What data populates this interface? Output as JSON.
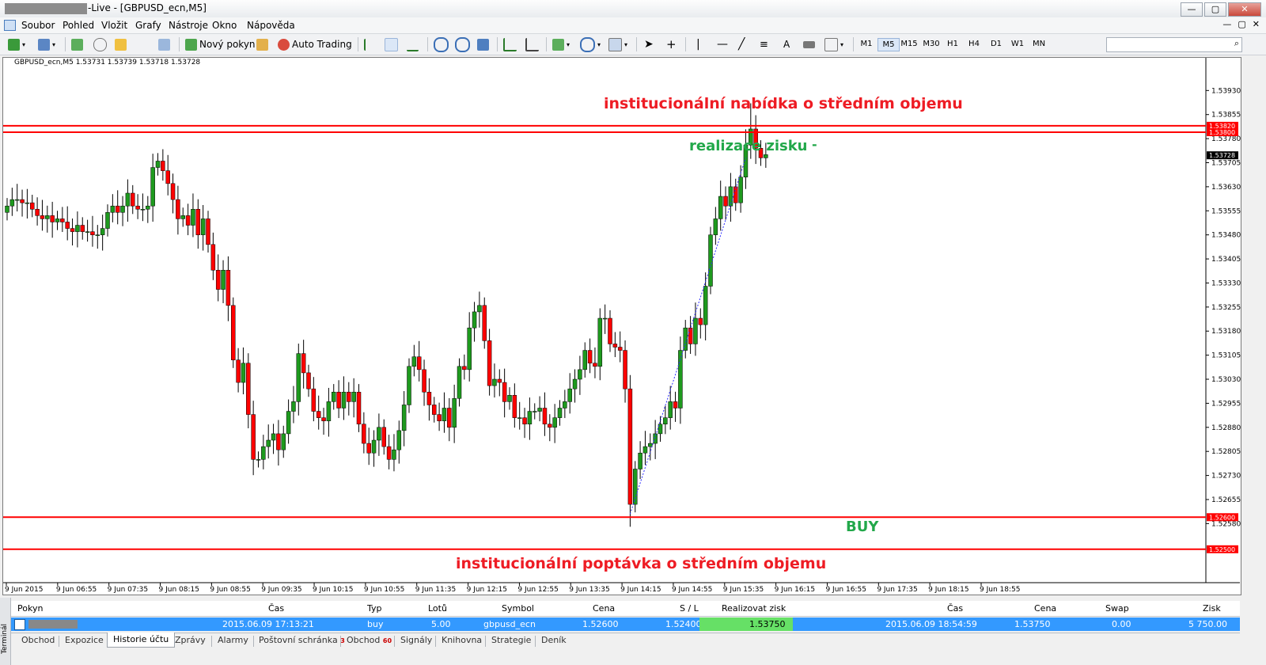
{
  "window": {
    "title": "-Live - [GBPUSD_ecn,M5]",
    "min": "—",
    "max": "▢",
    "close": "✕"
  },
  "menu": [
    "Soubor",
    "Pohled",
    "Vložit",
    "Grafy",
    "Nástroje",
    "Okno",
    "Nápověda"
  ],
  "toolbar": {
    "new_order": "Nový pokyn",
    "auto_trading": "Auto Trading",
    "timeframes": [
      "M1",
      "M5",
      "M15",
      "M30",
      "H1",
      "H4",
      "D1",
      "W1",
      "MN"
    ],
    "active_timeframe": "M5",
    "line_label": "A",
    "icons": [
      "new-chart-icon",
      "profiles-icon",
      "market-watch-icon",
      "navigator-icon",
      "favorites-icon",
      "tester-icon",
      "new-order-icon",
      "auto-trading-icon",
      "bar-chart-icon",
      "candles-icon",
      "line-chart-icon",
      "zoom-in-icon",
      "zoom-out-icon",
      "tile-icon",
      "autoscroll-icon",
      "chart-shift-icon",
      "indicators-icon",
      "periods-icon",
      "templates-icon",
      "cursor-icon",
      "crosshair-icon",
      "vline-icon",
      "hline-icon",
      "trendline-icon",
      "channel-icon",
      "text-icon",
      "label-icon",
      "arrows-icon",
      "search-icon"
    ]
  },
  "chart_info": "GBPUSD_ecn,M5  1.53731 1.53739 1.53718 1.53728",
  "chart_data": {
    "type": "candlestick",
    "symbol": "GBPUSD_ecn,M5",
    "ohlc_last": [
      1.53731,
      1.53739,
      1.53718,
      1.53728
    ],
    "ylim": [
      1.5246,
      1.5399
    ],
    "y_ticks": [
      "1.53930",
      "1.53855",
      "1.53780",
      "1.53705",
      "1.53630",
      "1.53555",
      "1.53480",
      "1.53405",
      "1.53330",
      "1.53255",
      "1.53180",
      "1.53105",
      "1.53030",
      "1.52955",
      "1.52880",
      "1.52805",
      "1.52730",
      "1.52655",
      "1.52580"
    ],
    "x_ticks": [
      "9 Jun 2015",
      "9 Jun 06:55",
      "9 Jun 07:35",
      "9 Jun 08:15",
      "9 Jun 08:55",
      "9 Jun 09:35",
      "9 Jun 10:15",
      "9 Jun 10:55",
      "9 Jun 11:35",
      "9 Jun 12:15",
      "9 Jun 12:55",
      "9 Jun 13:35",
      "9 Jun 14:15",
      "9 Jun 14:55",
      "9 Jun 15:35",
      "9 Jun 16:15",
      "9 Jun 16:55",
      "9 Jun 17:35",
      "9 Jun 18:15",
      "9 Jun 18:55"
    ],
    "levels": [
      {
        "value": 1.5382,
        "label": "1.53820",
        "color": "#ff0000"
      },
      {
        "value": 1.538,
        "label": "1.53800",
        "color": "#ff0000"
      },
      {
        "value": 1.526,
        "label": "1.52600",
        "color": "#ff0000"
      },
      {
        "value": 1.525,
        "label": "1.52500",
        "color": "#ff0000"
      }
    ],
    "current_price": "1.53728",
    "closes": [
      1.5357,
      1.5359,
      1.5359,
      1.5358,
      1.5358,
      1.5356,
      1.5354,
      1.5353,
      1.5354,
      1.5352,
      1.5353,
      1.5352,
      1.535,
      1.5349,
      1.5351,
      1.5349,
      1.5349,
      1.5348,
      1.5348,
      1.535,
      1.5355,
      1.5357,
      1.5355,
      1.5357,
      1.5361,
      1.5357,
      1.5356,
      1.5356,
      1.5357,
      1.5369,
      1.5371,
      1.5368,
      1.5364,
      1.5359,
      1.5353,
      1.5354,
      1.5351,
      1.5356,
      1.5348,
      1.5353,
      1.5345,
      1.5337,
      1.5331,
      1.5337,
      1.5326,
      1.5309,
      1.5302,
      1.5308,
      1.5292,
      1.5278,
      1.5278,
      1.5282,
      1.5284,
      1.5286,
      1.5281,
      1.5286,
      1.5293,
      1.5296,
      1.5311,
      1.5305,
      1.53,
      1.5293,
      1.5291,
      1.529,
      1.5296,
      1.5299,
      1.5294,
      1.5299,
      1.5296,
      1.5299,
      1.5289,
      1.5283,
      1.528,
      1.5284,
      1.5288,
      1.5282,
      1.5278,
      1.5281,
      1.5287,
      1.5295,
      1.5307,
      1.531,
      1.5306,
      1.5299,
      1.5295,
      1.5292,
      1.529,
      1.5294,
      1.5288,
      1.5297,
      1.5307,
      1.5306,
      1.5319,
      1.5324,
      1.5326,
      1.5315,
      1.5301,
      1.5303,
      1.5302,
      1.5296,
      1.5298,
      1.5291,
      1.5291,
      1.5289,
      1.5293,
      1.5293,
      1.5294,
      1.5289,
      1.5288,
      1.5291,
      1.5294,
      1.5296,
      1.53,
      1.5303,
      1.5306,
      1.5312,
      1.5308,
      1.5307,
      1.5322,
      1.5322,
      1.5314,
      1.5313,
      1.5312,
      1.53,
      1.5264,
      1.5275,
      1.528,
      1.5282,
      1.5283,
      1.5286,
      1.5289,
      1.5291,
      1.5296,
      1.5294,
      1.5312,
      1.5319,
      1.5314,
      1.5322,
      1.532,
      1.5332,
      1.5348,
      1.5353,
      1.536,
      1.5357,
      1.5363,
      1.5358,
      1.5366,
      1.5376,
      1.5381,
      1.5375,
      1.5372,
      1.5373
    ]
  },
  "annotations": {
    "top_level": "institucionální nabídka o středním objemu",
    "profit": "realizace zisku",
    "profit_dash": "-",
    "buy": "BUY",
    "bottom_level": "institucionální poptávka o středním objemu"
  },
  "terminal": {
    "side_label": "Terminál",
    "columns": [
      "Pokyn",
      "Čas",
      "Typ",
      "Lotů",
      "Symbol",
      "Cena",
      "S / L",
      "Realizovat zisk",
      "Čas",
      "Cena",
      "Swap",
      "Zisk"
    ],
    "row": {
      "time_open": "2015.06.09 17:13:21",
      "type": "buy",
      "lots": "5.00",
      "symbol": "gbpusd_ecn",
      "price_open": "1.52600",
      "sl": "1.52400",
      "tp": "1.53750",
      "time_close": "2015.06.09 18:54:59",
      "price_close": "1.53750",
      "swap": "0.00",
      "profit": "5 750.00"
    },
    "tabs": [
      {
        "label": "Obchod"
      },
      {
        "label": "Expozice"
      },
      {
        "label": "Historie účtu"
      },
      {
        "label": "Zprávy"
      },
      {
        "label": "Alarmy"
      },
      {
        "label": "Poštovní schránka",
        "badge": "3"
      },
      {
        "label": "Obchod",
        "badge": "60"
      },
      {
        "label": "Signály"
      },
      {
        "label": "Knihovna"
      },
      {
        "label": "Strategie"
      },
      {
        "label": "Deník"
      }
    ],
    "active_tab": "Historie účtu"
  }
}
